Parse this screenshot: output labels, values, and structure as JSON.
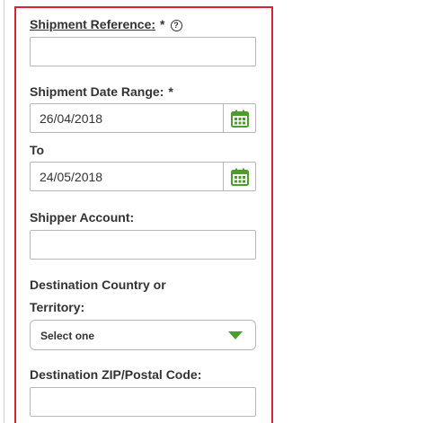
{
  "form": {
    "shipment_reference": {
      "label": "Shipment Reference:",
      "required_mark": "*",
      "help_icon": "?",
      "value": ""
    },
    "date_range": {
      "label": "Shipment Date Range:",
      "required_mark": "*",
      "from_value": "26/04/2018",
      "to_label": "To",
      "to_value": "24/05/2018",
      "calendar_icon": "calendar-icon"
    },
    "shipper_account": {
      "label": "Shipper Account:",
      "value": ""
    },
    "destination_country": {
      "label_line1": "Destination Country or",
      "label_line2": "Territory:",
      "selected": "Select one",
      "dropdown_icon": "chevron-down-icon"
    },
    "destination_zip": {
      "label": "Destination ZIP/Postal Code:",
      "value": ""
    }
  },
  "colors": {
    "highlight_border": "#d9232e",
    "accent_green": "#4d9c2d",
    "field_border": "#b7b7b7",
    "text": "#333333"
  }
}
